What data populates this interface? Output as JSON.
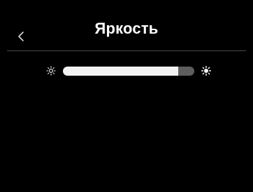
{
  "header": {
    "title": "Яркость",
    "back_icon": "chevron-left-icon"
  },
  "brightness": {
    "level": 0.88,
    "min_icon": "sun-small-icon",
    "max_icon": "sun-large-icon"
  },
  "colors": {
    "background": "#000000",
    "text": "#ffffff",
    "divider": "#4a4a4a",
    "slider_fill": "#f2f2f2",
    "slider_track": "#5e5e5e"
  }
}
